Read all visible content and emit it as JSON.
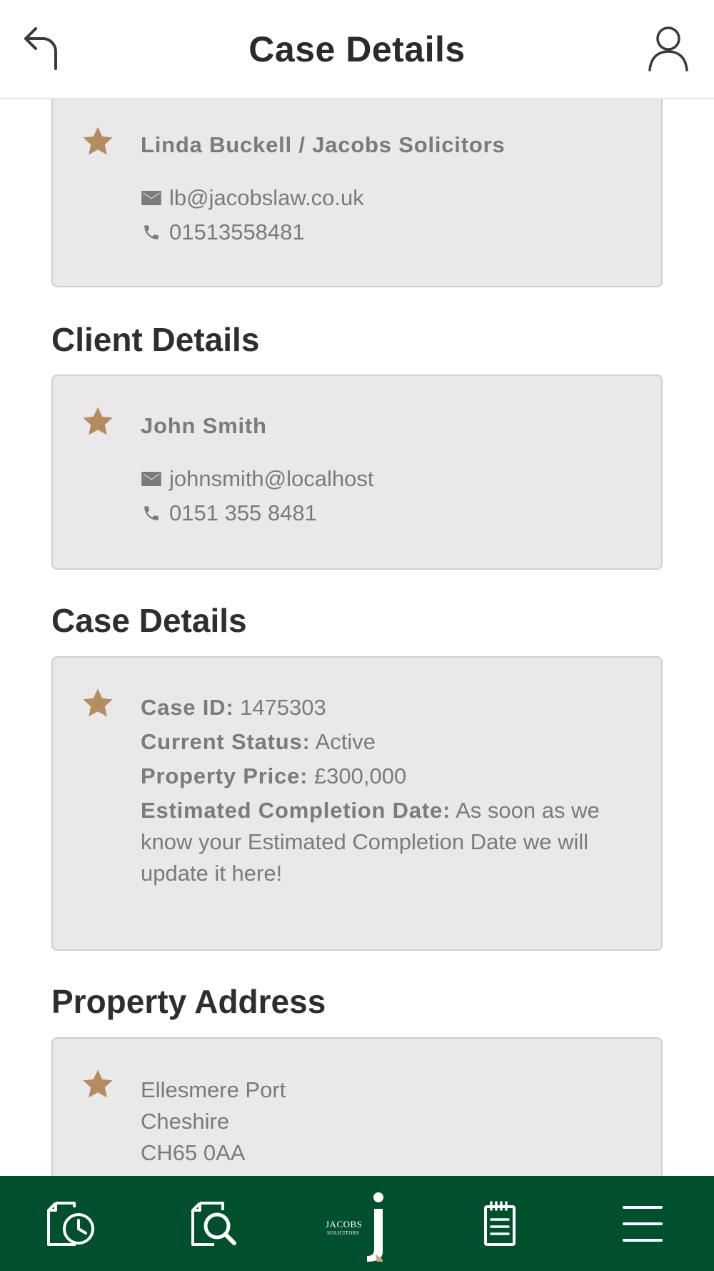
{
  "header": {
    "title": "Case Details",
    "back_icon": "back-arrow-icon",
    "user_icon": "user-icon"
  },
  "solicitor_card": {
    "name": "Linda Buckell / Jacobs Solicitors",
    "email": "lb@jacobslaw.co.uk",
    "phone": "01513558481"
  },
  "client_section": {
    "title": "Client Details",
    "name": "John Smith",
    "email": "johnsmith@localhost",
    "phone": "0151 355 8481"
  },
  "case_section": {
    "title": "Case Details",
    "case_id_label": "Case ID:",
    "case_id": "1475303",
    "status_label": "Current Status:",
    "status": "Active",
    "price_label": "Property Price:",
    "price": "£300,000",
    "completion_label": "Estimated Completion Date:",
    "completion": "As soon as we know your Estimated Completion Date we will update it here!"
  },
  "address_section": {
    "title": "Property Address",
    "line1": "Ellesmere Port",
    "line2": "Cheshire",
    "line3": "CH65 0AA"
  },
  "tabbar": {
    "tabs": [
      {
        "icon": "case-history-icon"
      },
      {
        "icon": "search-document-icon"
      },
      {
        "icon": "jacobs-logo-icon",
        "logo_text_1": "JACOBS",
        "logo_text_2": "SOLICITORS"
      },
      {
        "icon": "notepad-icon"
      },
      {
        "icon": "menu-icon"
      }
    ]
  },
  "colors": {
    "accent_star": "#b48c5f",
    "tabbar_bg": "#00502d",
    "card_bg": "#e9e9e9"
  }
}
